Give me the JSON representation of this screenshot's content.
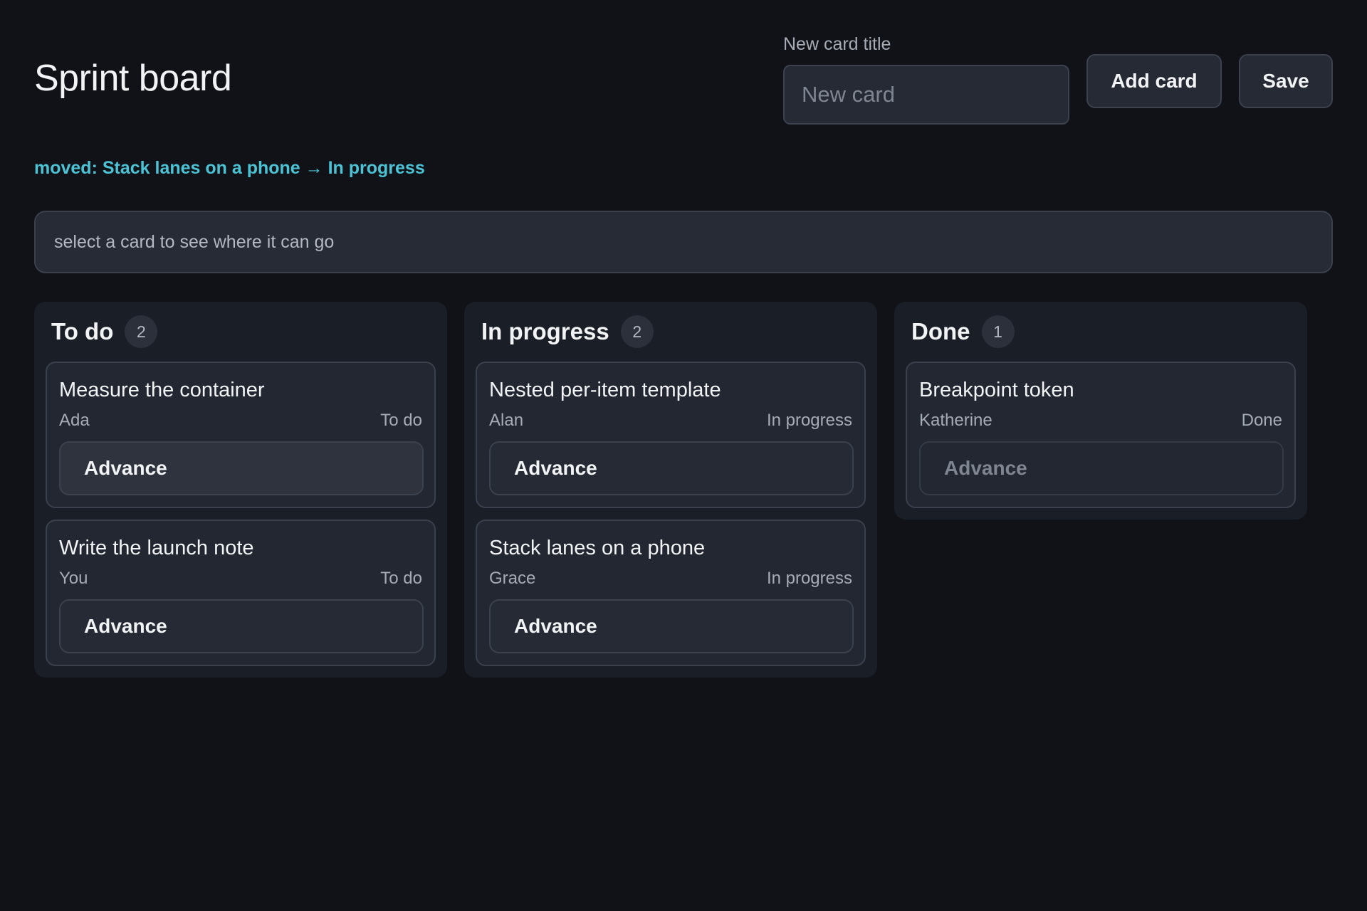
{
  "header": {
    "title": "Sprint board",
    "new_card_label": "New card title",
    "new_card_placeholder": "New card",
    "new_card_value": "",
    "add_card_label": "Add card",
    "save_label": "Save"
  },
  "status": "moved: Stack lanes on a phone → In progress",
  "hint": "select a card to see where it can go",
  "lanes": [
    {
      "title": "To do",
      "count": "2",
      "cards": [
        {
          "title": "Measure the container",
          "assignee": "Ada",
          "stage": "To do",
          "action": "Advance"
        },
        {
          "title": "Write the launch note",
          "assignee": "You",
          "stage": "To do",
          "action": "Advance"
        }
      ]
    },
    {
      "title": "In progress",
      "count": "2",
      "cards": [
        {
          "title": "Nested per-item template",
          "assignee": "Alan",
          "stage": "In progress",
          "action": "Advance"
        },
        {
          "title": "Stack lanes on a phone",
          "assignee": "Grace",
          "stage": "In progress",
          "action": "Advance"
        }
      ]
    },
    {
      "title": "Done",
      "count": "1",
      "cards": [
        {
          "title": "Breakpoint token",
          "assignee": "Katherine",
          "stage": "Done",
          "action": "Advance"
        }
      ]
    }
  ],
  "colors": {
    "background": "#101217",
    "accent": "#4cc3d5",
    "surface": "#252a34",
    "lane": "#1a1e26"
  }
}
